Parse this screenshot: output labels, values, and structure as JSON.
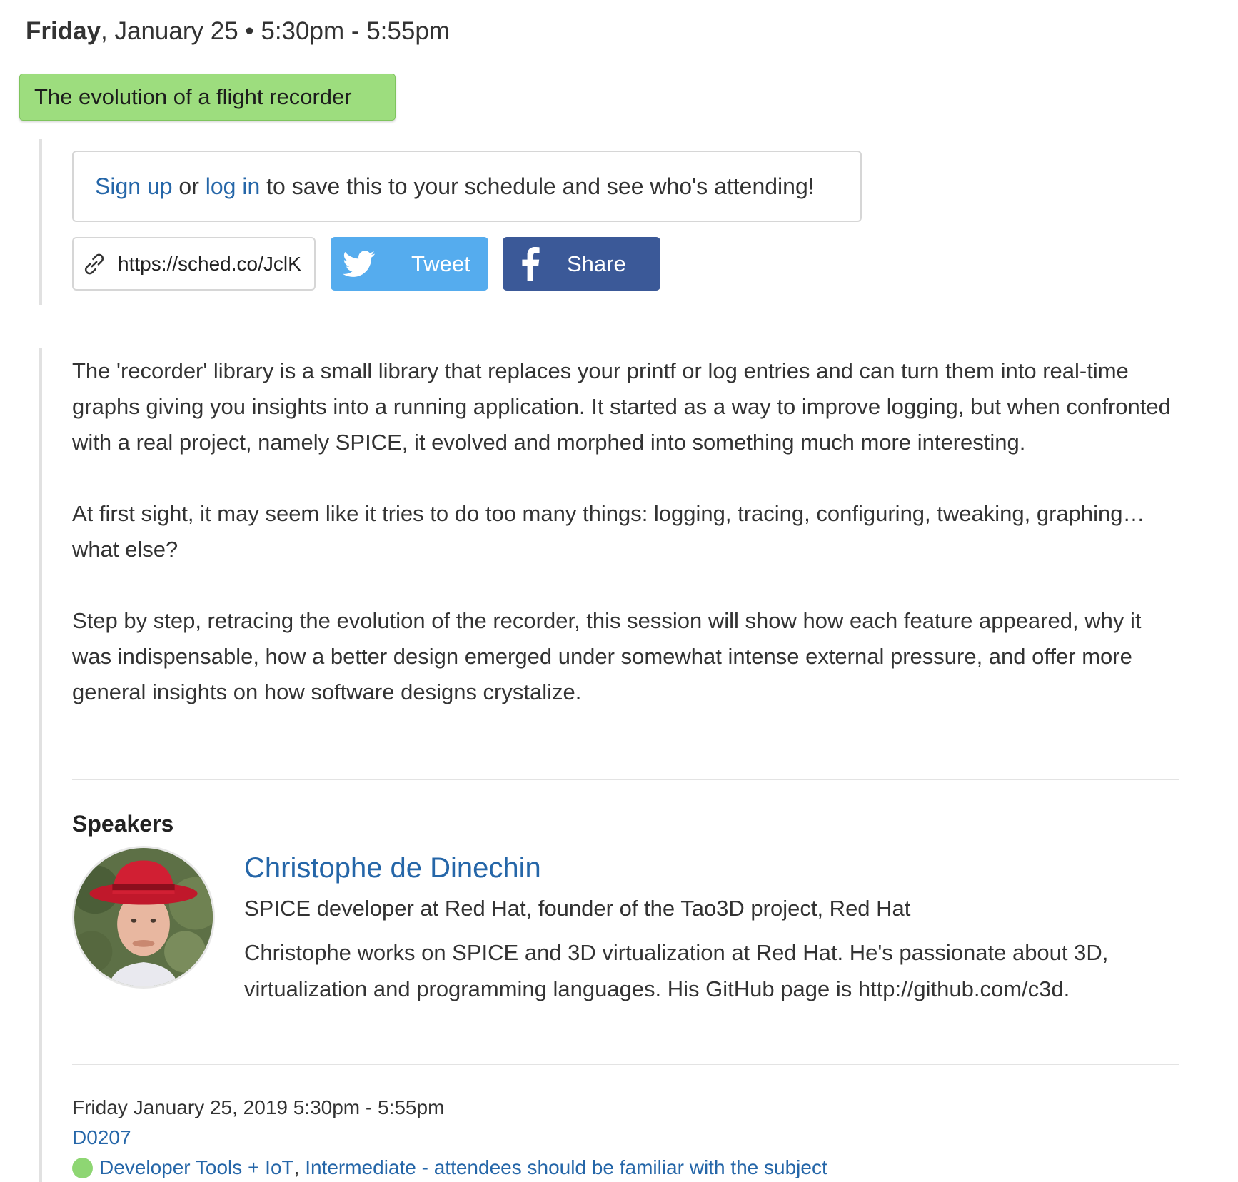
{
  "session": {
    "day": "Friday",
    "date_rest": ", January 25 • 5:30pm - 5:55pm",
    "title": "The evolution of a flight recorder",
    "title_color": "#9ddd7e"
  },
  "signup": {
    "signup_link": "Sign up",
    "or_text": " or ",
    "login_link": "log in",
    "rest": " to save this to your schedule and see who's attending!"
  },
  "share": {
    "short_url": "https://sched.co/JclK",
    "link_icon": "link-icon",
    "tweet_label": "Tweet",
    "tweet_icon": "twitter-icon",
    "tweet_color": "#55acee",
    "share_label": "Share",
    "share_icon": "facebook-icon",
    "share_color": "#3b5998"
  },
  "description": {
    "paragraphs": [
      "The 'recorder' library is a small library that replaces your printf or log entries and can turn them into real-time graphs giving you insights into a running application. It started as a way to improve logging, but when confronted with a real project, namely SPICE, it evolved and morphed into something much more interesting.",
      "At first sight, it may seem like it tries to do too many things: logging, tracing, configuring, tweaking, graphing… what else?",
      "Step by step, retracing the evolution of the recorder, this session will show how each feature appeared, why it was indispensable, how a better design emerged under somewhat intense external pressure, and offer more general insights on how software designs crystalize."
    ]
  },
  "speakers": {
    "heading": "Speakers",
    "items": [
      {
        "name": "Christophe de Dinechin",
        "role": "SPICE developer at Red Hat, founder of the Tao3D project, Red Hat",
        "bio": "Christophe works on SPICE and 3D virtualization at Red Hat. He's passionate about 3D, virtualization and programming languages. His GitHub page is http://github.com/c3d."
      }
    ]
  },
  "footer": {
    "datetime": "Friday January 25, 2019 5:30pm - 5:55pm",
    "room": "D0207",
    "track": "Developer Tools + IoT",
    "separator": ", ",
    "level": "Intermediate - attendees should be familiar with the subject",
    "dot_color": "#8ed673"
  },
  "colors": {
    "link": "#2566a8",
    "text": "#333333"
  }
}
